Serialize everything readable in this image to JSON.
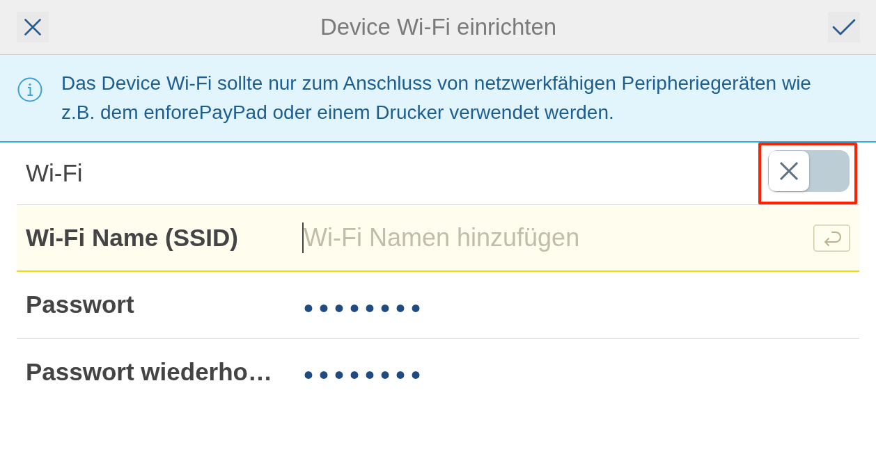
{
  "header": {
    "title": "Device Wi-Fi einrichten"
  },
  "info_banner": {
    "text": "Das Device Wi-Fi sollte nur zum Anschluss von netzwerkfähigen Peripheriegeräten wie z.B. dem enforePayPad oder einem Drucker verwendet werden."
  },
  "wifi_toggle": {
    "label": "Wi-Fi",
    "on": false,
    "highlighted": true
  },
  "fields": [
    {
      "label": "Wi-Fi Name (SSID)",
      "placeholder": "Wi-Fi Namen hinzufügen",
      "focused": true
    },
    {
      "label": "Passwort",
      "value": "••••••••",
      "focused": false
    },
    {
      "label": "Passwort wiederho…",
      "value": "••••••••",
      "focused": false
    }
  ]
}
